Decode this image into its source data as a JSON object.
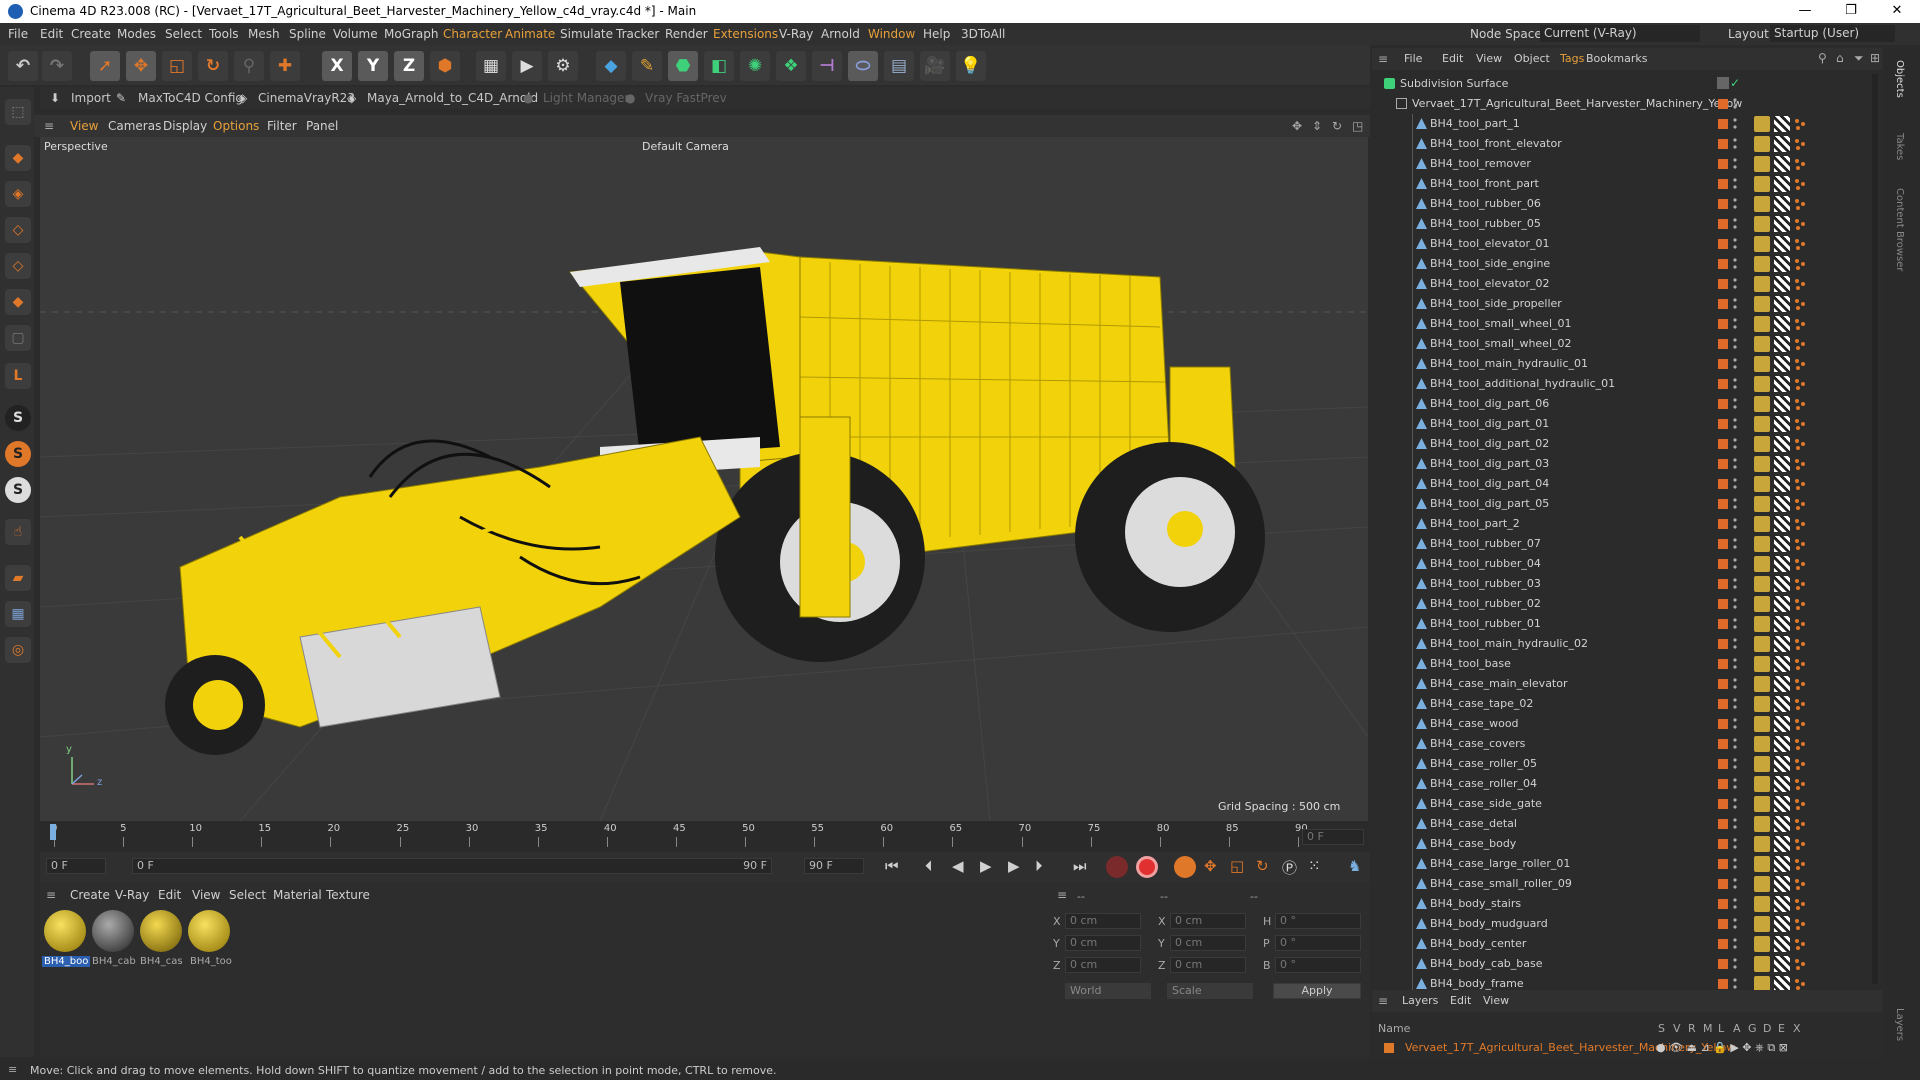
{
  "window": {
    "title": "Cinema 4D R23.008 (RC) - [Vervaet_17T_Agricultural_Beet_Harvester_Machinery_Yellow_c4d_vray.c4d *] - Main",
    "minimize": "—",
    "maximize": "❐",
    "close": "✕"
  },
  "menu": {
    "items": [
      "File",
      "Edit",
      "Create",
      "Modes",
      "Select",
      "Tools",
      "Mesh",
      "Spline",
      "Volume",
      "MoGraph",
      "Character",
      "Animate",
      "Simulate",
      "Tracker",
      "Render",
      "Extensions",
      "V-Ray",
      "Arnold",
      "Window",
      "Help",
      "3DToAll"
    ],
    "node_space_label": "Node Space:",
    "node_space_value": "Current (V-Ray)",
    "layout_label": "Layout:",
    "layout_value": "Startup (User)"
  },
  "plugins": {
    "items": [
      "Import",
      "MaxToC4D Config",
      "CinemaVrayR23",
      "Maya_Arnold_to_C4D_Arnold",
      "Light Manager",
      "Vray FastPrev"
    ]
  },
  "viewport": {
    "menu": [
      "View",
      "Cameras",
      "Display",
      "Options",
      "Filter",
      "Panel"
    ],
    "label": "Perspective",
    "camera": "Default Camera",
    "grid_spacing": "Grid Spacing : 500 cm",
    "axis_y": "y",
    "axis_z": "z"
  },
  "timeline": {
    "ticks": [
      "0",
      "5",
      "10",
      "15",
      "20",
      "25",
      "30",
      "35",
      "40",
      "45",
      "50",
      "55",
      "60",
      "65",
      "70",
      "75",
      "80",
      "85",
      "90"
    ],
    "current_frame_box": "0 F"
  },
  "transport": {
    "start": "0 F",
    "current": "0 F",
    "end_a": "90 F",
    "end_b": "90 F"
  },
  "materials": {
    "menu": [
      "Create",
      "V-Ray",
      "Edit",
      "View",
      "Select",
      "Material",
      "Texture"
    ],
    "items": [
      "BH4_boo",
      "BH4_cab",
      "BH4_cas",
      "BH4_too"
    ]
  },
  "attributes": {
    "header_a": "--",
    "header_b": "--",
    "header_c": "--",
    "x": "X",
    "y": "Y",
    "z": "Z",
    "x2": "X",
    "y2": "Y",
    "z2": "Z",
    "h": "H",
    "p": "P",
    "b": "B",
    "pos_x": "0 cm",
    "pos_y": "0 cm",
    "pos_z": "0 cm",
    "size_x": "0 cm",
    "size_y": "0 cm",
    "size_z": "0 cm",
    "rot_h": "0 °",
    "rot_p": "0 °",
    "rot_b": "0 °",
    "mode_a": "World",
    "mode_b": "Scale",
    "apply": "Apply"
  },
  "objects": {
    "menu": [
      "File",
      "Edit",
      "View",
      "Object",
      "Tags",
      "Bookmarks"
    ],
    "root": "Subdivision Surface",
    "group": "Vervaet_17T_Agricultural_Beet_Harvester_Machinery_Yellow",
    "rows": [
      "BH4_tool_part_1",
      "BH4_tool_front_elevator",
      "BH4_tool_remover",
      "BH4_tool_front_part",
      "BH4_tool_rubber_06",
      "BH4_tool_rubber_05",
      "BH4_tool_elevator_01",
      "BH4_tool_side_engine",
      "BH4_tool_elevator_02",
      "BH4_tool_side_propeller",
      "BH4_tool_small_wheel_01",
      "BH4_tool_small_wheel_02",
      "BH4_tool_main_hydraulic_01",
      "BH4_tool_additional_hydraulic_01",
      "BH4_tool_dig_part_06",
      "BH4_tool_dig_part_01",
      "BH4_tool_dig_part_02",
      "BH4_tool_dig_part_03",
      "BH4_tool_dig_part_04",
      "BH4_tool_dig_part_05",
      "BH4_tool_part_2",
      "BH4_tool_rubber_07",
      "BH4_tool_rubber_04",
      "BH4_tool_rubber_03",
      "BH4_tool_rubber_02",
      "BH4_tool_rubber_01",
      "BH4_tool_main_hydraulic_02",
      "BH4_tool_base",
      "BH4_case_main_elevator",
      "BH4_case_tape_02",
      "BH4_case_wood",
      "BH4_case_covers",
      "BH4_case_roller_05",
      "BH4_case_roller_04",
      "BH4_case_side_gate",
      "BH4_case_detal",
      "BH4_case_body",
      "BH4_case_large_roller_01",
      "BH4_case_small_roller_09",
      "BH4_body_stairs",
      "BH4_body_mudguard",
      "BH4_body_center",
      "BH4_body_cab_base",
      "BH4_body_frame"
    ]
  },
  "layers": {
    "menu": [
      "Layers",
      "Edit",
      "View"
    ],
    "name_header": "Name",
    "cols": [
      "S",
      "V",
      "R",
      "M",
      "L",
      "A",
      "G",
      "D",
      "E",
      "X"
    ],
    "layer_name": "Vervaet_17T_Agricultural_Beet_Harvester_Machinery_Yellow"
  },
  "side_tabs": [
    "Objects",
    "Takes",
    "Content Browser",
    "Layers"
  ],
  "status": "Move: Click and drag to move elements. Hold down SHIFT to quantize movement / add to the selection in point mode, CTRL to remove.",
  "colors": {
    "accent_orange": "#e0782a",
    "machine_yellow": "#f2d20a",
    "layer_text": "#e07a2a"
  }
}
